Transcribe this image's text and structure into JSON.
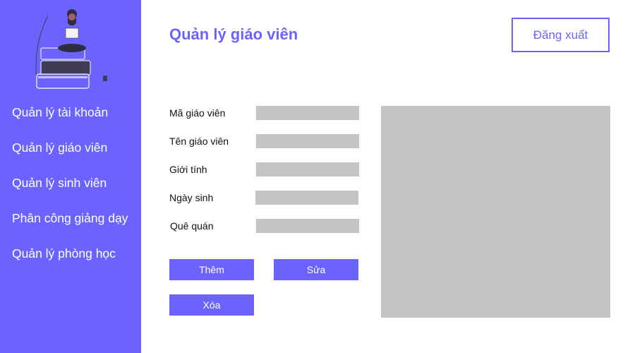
{
  "sidebar": {
    "illustration_icon": "woman-reading-on-books-illustration",
    "items": [
      {
        "label": "Quản lý tài khoản"
      },
      {
        "label": "Quản lý giáo viên"
      },
      {
        "label": "Quản lý sinh viên"
      },
      {
        "label": "Phân công giảng dạy"
      },
      {
        "label": "Quản lý phòng học"
      }
    ]
  },
  "header": {
    "title": "Quản lý giáo viên",
    "logout_label": "Đăng xuất"
  },
  "form": {
    "fields": [
      {
        "label": "Mã giáo viên",
        "value": ""
      },
      {
        "label": "Tên giáo viên",
        "value": ""
      },
      {
        "label": "Giới tính",
        "value": ""
      },
      {
        "label": "Ngày sinh",
        "value": ""
      },
      {
        "label": "Quê quán",
        "value": ""
      }
    ]
  },
  "actions": {
    "add_label": "Thêm",
    "edit_label": "Sửa",
    "delete_label": "Xóa"
  },
  "colors": {
    "accent": "#6c63ff",
    "placeholder_gray": "#c4c4c4"
  }
}
